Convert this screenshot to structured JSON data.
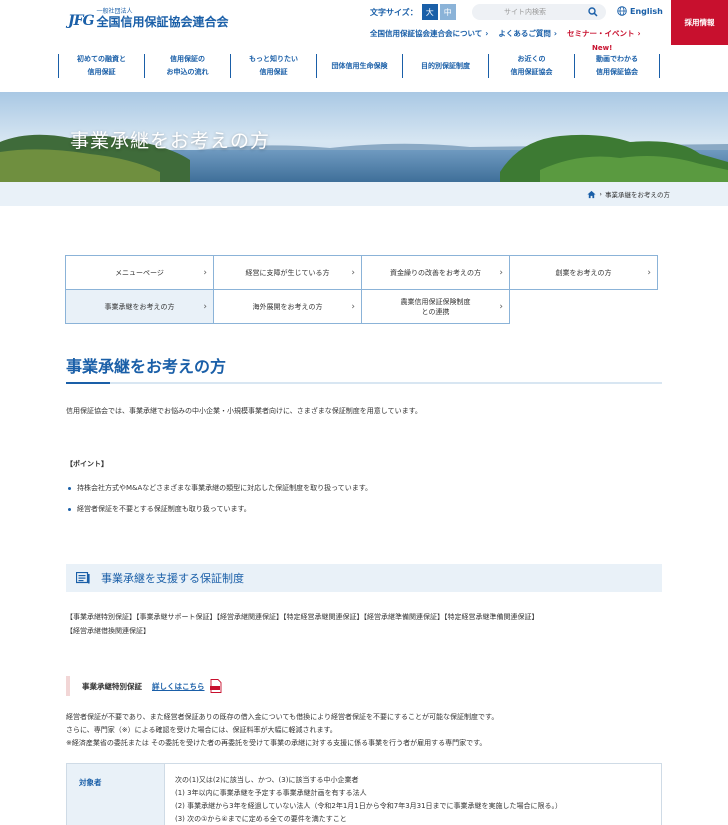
{
  "header": {
    "logo_mark": "JFG",
    "logo_small": "一般社団法人",
    "logo_main": "全国信用保証協会連合会",
    "fontsize_label": "文字サイズ：",
    "fontsize_large": "大",
    "fontsize_mid": "中",
    "search_placeholder": "サイト内検索",
    "english": "English",
    "recruit": "採用情報",
    "new_badge": "New!",
    "sublinks": [
      "全国信用保証協会連合会について",
      "よくあるご質問",
      "セミナー・イベント"
    ],
    "gnav": [
      "初めての融資と\n信用保証",
      "信用保証の\nお申込の流れ",
      "もっと知りたい\n信用保証",
      "団体信用生命保険",
      "目的別保証制度",
      "お近くの\n信用保証協会",
      "動画でわかる\n信用保証協会"
    ]
  },
  "hero": {
    "title": "事業承継をお考えの方"
  },
  "breadcrumb": {
    "current": "事業承継をお考えの方"
  },
  "local_nav": {
    "row1": [
      "メニューページ",
      "経営に支障が生じている方",
      "資金繰りの改善をお考えの方",
      "創業をお考えの方"
    ],
    "row2": [
      "事業承継をお考えの方",
      "海外展開をお考えの方",
      "農業信用保証保険制度\nとの連携"
    ]
  },
  "main": {
    "title": "事業承継をお考えの方",
    "intro": "信用保証協会では、事業承継でお悩みの中小企業・小規模事業者向けに、さまざまな保証制度を用意しています。",
    "point_head": "【ポイント】",
    "bullets": [
      "持株会社方式やM&Aなどさまざまな事業承継の類型に対応した保証制度を取り扱っています。",
      "経営者保証を不要とする保証制度も取り扱っています。"
    ],
    "section_title": "事業承継を支援する保証制度",
    "tags_line1": "【事業承継特別保証】【事業承継サポート保証】【経営承継関連保証】【特定経営承継関連保証】【経営承継準備関連保証】【特定経営承継準備関連保証】",
    "tags_line2": "【経営承継借換関連保証】",
    "sub_title": "事業承継特別保証",
    "sub_link": "詳しくはこちら",
    "desc_lines": [
      "経営者保証が不要であり、また経営者保証ありの既存の借入金についても借換により経営者保証を不要にすることが可能な保証制度です。",
      "さらに、専門家（※）による確認を受けた場合には、保証料率が大幅に軽減されます。",
      "※経済産業省の委託または その委託を受けた者の再委託を受けて事業の承継に対する支援に係る事業を行う者が雇用する専門家です。"
    ],
    "table": {
      "th": "対象者",
      "lines": [
        "次の(1)又は(2)に該当し、かつ、(3)に該当する中小企業者",
        "(1) 3年以内に事業承継を予定する事業承継計画を有する法人",
        "(2) 事業承継から3年を経過していない法人（令和2年1月1日から令和7年3月31日までに事業承継を実施した場合に限る。）",
        "(3) 次の①から④までに定める全ての要件を満たすこと"
      ]
    }
  },
  "colors": {
    "primary": "#1a5fa8",
    "accent_red": "#c8102e",
    "light_bg": "#e9f1f8"
  }
}
